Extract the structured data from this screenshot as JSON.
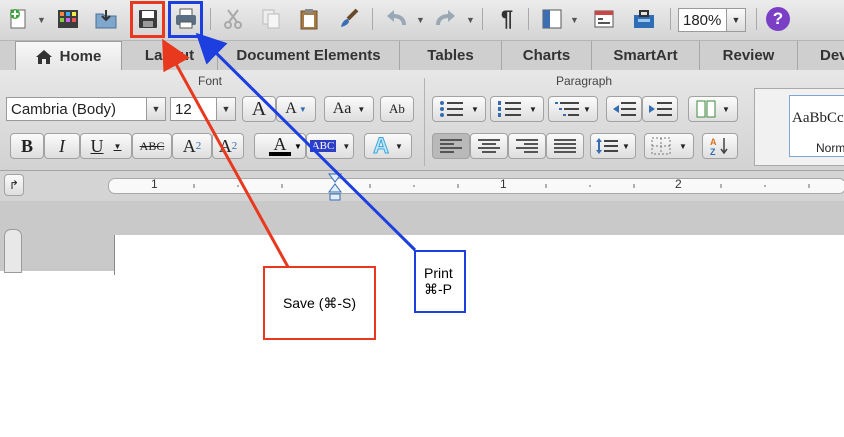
{
  "toolbar": {
    "zoom_value": "180%",
    "paragraph_glyph": "¶",
    "help_glyph": "?",
    "buttons": [
      "new-document",
      "template-gallery",
      "open",
      "save",
      "print",
      "cut",
      "copy",
      "paste",
      "format-painter",
      "undo",
      "redo",
      "show-paragraph-marks",
      "sidebar",
      "media-browser",
      "toolbox",
      "zoom",
      "help"
    ]
  },
  "tabs": [
    {
      "label": "Home",
      "active": true
    },
    {
      "label": "Layout"
    },
    {
      "label": "Document Elements"
    },
    {
      "label": "Tables"
    },
    {
      "label": "Charts"
    },
    {
      "label": "SmartArt"
    },
    {
      "label": "Review"
    },
    {
      "label": "Dev"
    }
  ],
  "ribbon": {
    "font_group_title": "Font",
    "paragraph_group_title": "Paragraph",
    "font_name": "Cambria (Body)",
    "font_size": "12",
    "grow_font": "A",
    "shrink_font": "A",
    "change_case": "Aa",
    "clear_formatting": "Ab",
    "bold": "B",
    "italic": "I",
    "underline": "U",
    "strikethrough": "ABC",
    "superscript": "A",
    "superscript_mark": "2",
    "subscript": "A",
    "subscript_mark": "2",
    "font_color": "A",
    "highlight": "ABC",
    "text_effects": "A",
    "style_preview": "AaBbCc",
    "style_name": "Norm"
  },
  "ruler": {
    "marks": [
      "1",
      "1",
      "2"
    ]
  },
  "annotations": {
    "save_callout": "Save (⌘-S)",
    "print_callout_line1": "Print",
    "print_callout_line2": "⌘-P",
    "save_color": "#e8381e",
    "print_color": "#1d3fe0"
  }
}
